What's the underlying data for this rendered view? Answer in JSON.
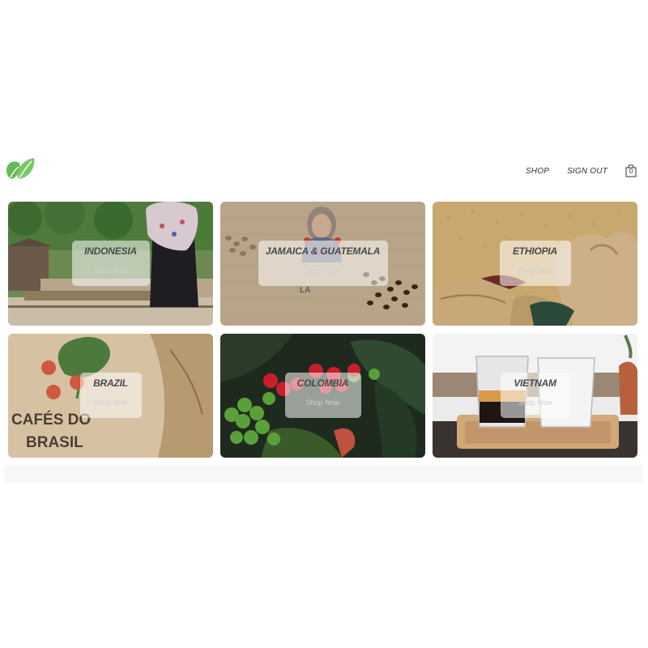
{
  "nav": {
    "shop_label": "SHOP",
    "signout_label": "SIGN OUT",
    "cart_count": "0",
    "logo_icon": "leaf-logo-icon",
    "cart_icon": "shopping-bag-icon"
  },
  "colors": {
    "logo_green": "#66bb55",
    "overlay": "#ffffff",
    "title_text": "#4a4a4a"
  },
  "regions": [
    {
      "name": "INDONESIA",
      "link": "Shop Now"
    },
    {
      "name": "JAMAICA & GUATEMALA",
      "link": "Shop Now"
    },
    {
      "name": "ETHIOPIA",
      "link": "Shop Now"
    },
    {
      "name": "BRAZIL",
      "link": "Shop Now"
    },
    {
      "name": "COLOMBIA",
      "link": "Shop Now"
    },
    {
      "name": "VIETNAM",
      "link": "Shop Now"
    }
  ],
  "sack_text": {
    "line1": "CAFÉS DO",
    "line2": "BRASIL",
    "jamaica_stamp": "LA"
  }
}
